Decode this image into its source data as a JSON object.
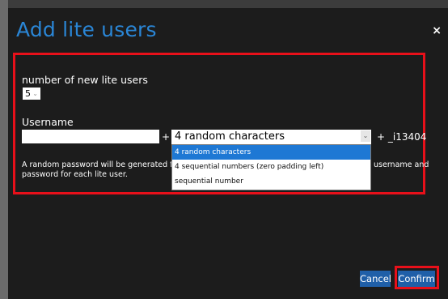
{
  "modal": {
    "title": "Add lite users",
    "close_glyph": "×"
  },
  "form": {
    "count_label": "number of new lite users",
    "count_value": "5",
    "username_label": "Username",
    "username_value": "",
    "plus": "+",
    "pattern_selected": "4 random characters",
    "suffix": "+ _i13404",
    "info_line1": "A random password will be generated fo",
    "info_line2": "password for each lite user.",
    "info_right": "username and",
    "options": [
      "4 random characters",
      "4 sequential numbers (zero padding left)",
      "sequential number"
    ]
  },
  "buttons": {
    "cancel": "Cancel",
    "confirm": "Confirm"
  },
  "colors": {
    "title": "#2a86d6",
    "button": "#1f5fa8",
    "highlight": "#e8101a",
    "option_selected": "#1e78d4"
  }
}
